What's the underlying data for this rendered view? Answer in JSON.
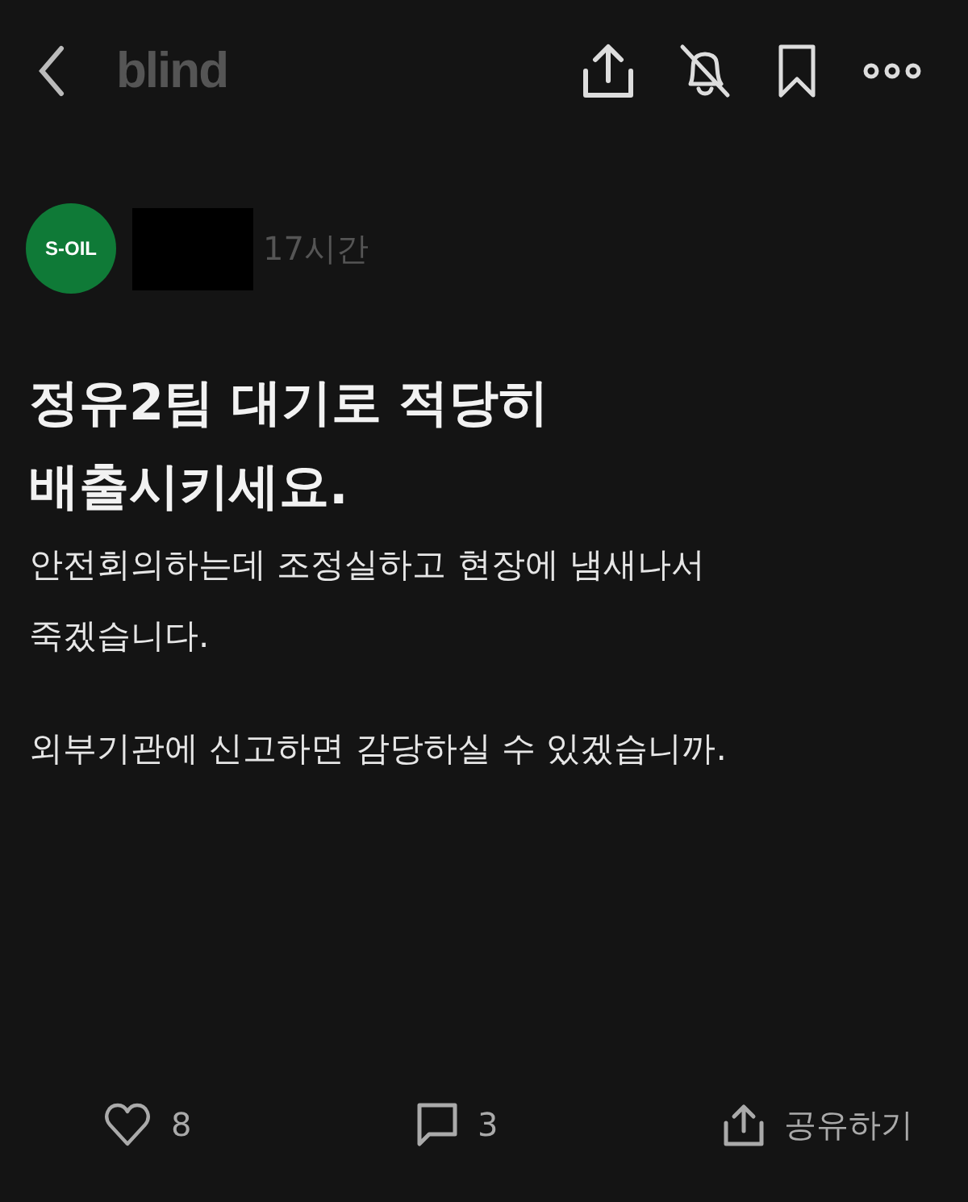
{
  "header": {
    "logo": "blind"
  },
  "author": {
    "company_logo": "S-OIL",
    "time": "17시간"
  },
  "post": {
    "title": "정유2팀 대기로 적당히 배출시키세요.",
    "paragraphs": [
      "안전회의하는데 조정실하고 현장에 냄새나서 죽겠습니다.",
      "외부기관에 신고하면 감당하실 수 있겠습니까."
    ]
  },
  "actions": {
    "likes": "8",
    "comments": "3",
    "share": "공유하기"
  }
}
